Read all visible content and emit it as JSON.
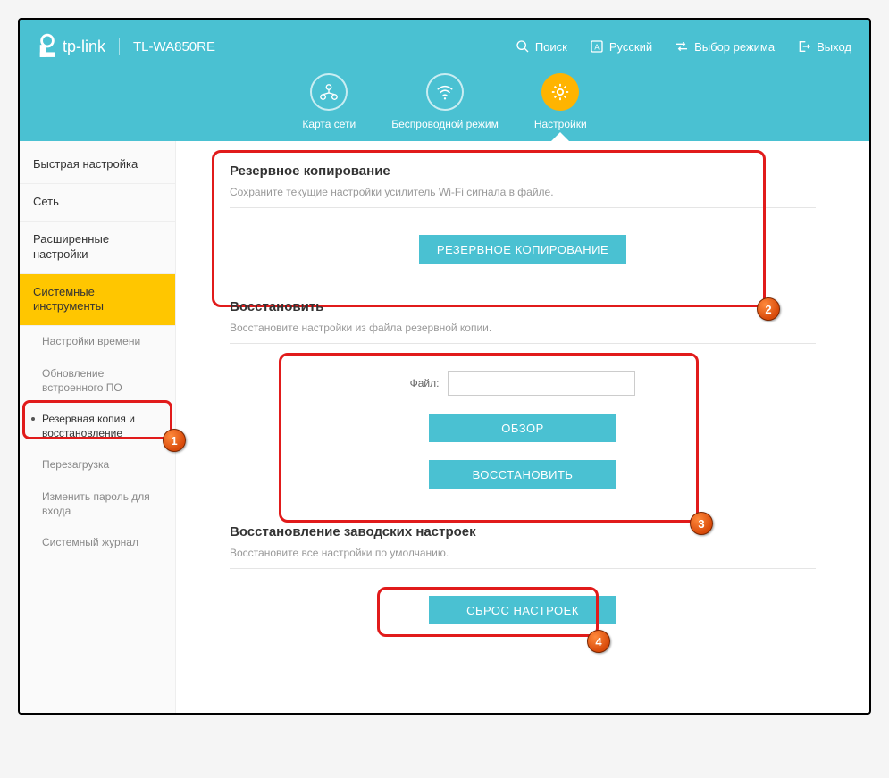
{
  "brand": "tp-link",
  "model": "TL-WA850RE",
  "header": {
    "search": "Поиск",
    "language": "Русский",
    "mode": "Выбор режима",
    "logout": "Выход"
  },
  "nav": {
    "map": "Карта сети",
    "wireless": "Беспроводной режим",
    "settings": "Настройки"
  },
  "sidebar": {
    "quick": "Быстрая настройка",
    "network": "Сеть",
    "advanced": "Расширенные настройки",
    "system": "Системные инструменты",
    "subs": {
      "time": "Настройки времени",
      "fw": "Обновление встроенного ПО",
      "backup": "Резервная копия и восстановление",
      "reboot": "Перезагрузка",
      "password": "Изменить пароль для входа",
      "log": "Системный журнал"
    }
  },
  "backup": {
    "title": "Резервное копирование",
    "desc": "Сохраните текущие настройки усилитель Wi-Fi сигнала в файле.",
    "button": "РЕЗЕРВНОЕ КОПИРОВАНИЕ"
  },
  "restore": {
    "title": "Восстановить",
    "desc": "Восстановите настройки из файла резервной копии.",
    "file_label": "Файл:",
    "file_value": "",
    "browse": "ОБЗОР",
    "button": "ВОССТАНОВИТЬ"
  },
  "reset": {
    "title": "Восстановление заводских настроек",
    "desc": "Восстановите все настройки по умолчанию.",
    "button": "СБРОС НАСТРОЕК"
  },
  "annotations": {
    "b1": "1",
    "b2": "2",
    "b3": "3",
    "b4": "4"
  }
}
